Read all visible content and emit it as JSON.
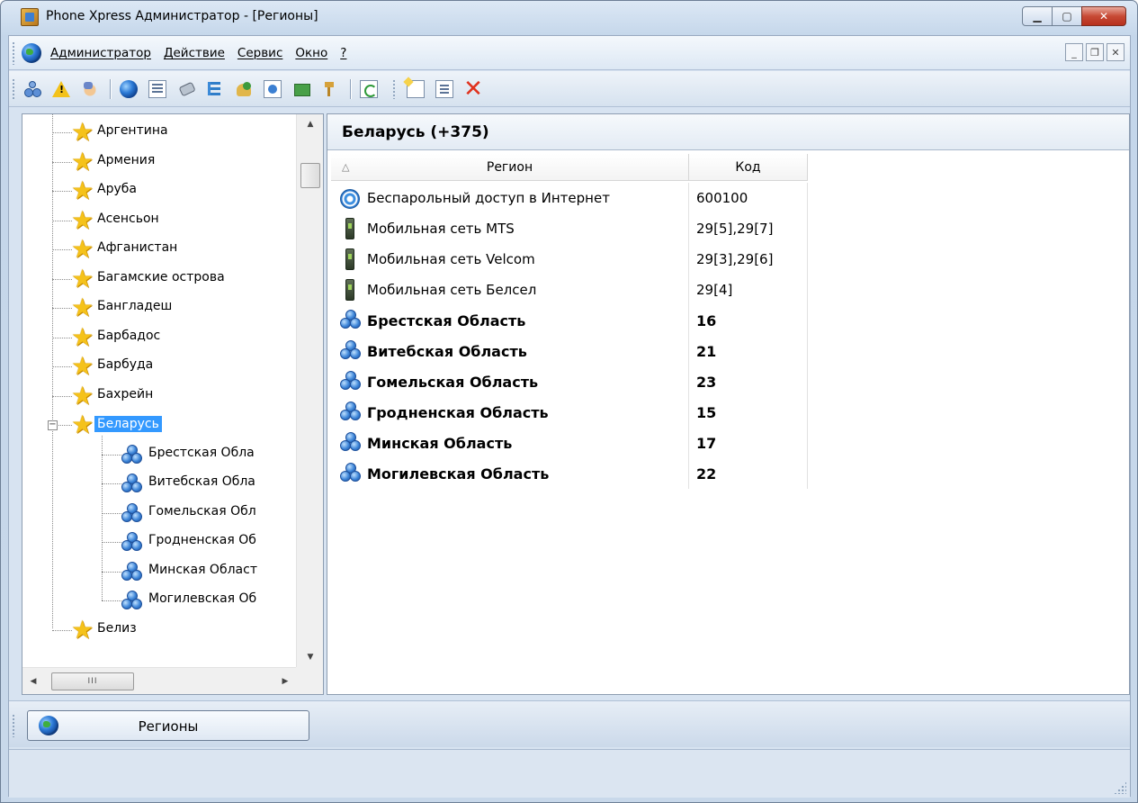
{
  "window": {
    "title": "Phone Xpress Администратор - [Регионы]",
    "caption_buttons": [
      "minimize",
      "maximize",
      "close"
    ]
  },
  "menubar": {
    "items": [
      "Администратор",
      "Действие",
      "Сервис",
      "Окно",
      "?"
    ],
    "mdi_buttons": [
      "minimize",
      "restore",
      "close"
    ]
  },
  "toolbar": {
    "icons": [
      "network-icon",
      "warning-icon",
      "hand-icon",
      "globe-icon",
      "list-icon",
      "phone-icon",
      "tree-icon",
      "users-icon",
      "document-icon",
      "money-icon",
      "keys-icon",
      "refresh-icon",
      "new-document-icon",
      "properties-icon",
      "delete-icon"
    ]
  },
  "tree": {
    "items": [
      {
        "label": "Аргентина",
        "type": "country"
      },
      {
        "label": "Армения",
        "type": "country"
      },
      {
        "label": "Аруба",
        "type": "country"
      },
      {
        "label": "Асенсьон",
        "type": "country"
      },
      {
        "label": "Афганистан",
        "type": "country"
      },
      {
        "label": "Багамские острова",
        "type": "country"
      },
      {
        "label": "Бангладеш",
        "type": "country"
      },
      {
        "label": "Барбадос",
        "type": "country"
      },
      {
        "label": "Барбуда",
        "type": "country"
      },
      {
        "label": "Бахрейн",
        "type": "country"
      },
      {
        "label": "Беларусь",
        "type": "country",
        "expanded": true,
        "selected": true
      },
      {
        "label": "Брестская Обла",
        "type": "region"
      },
      {
        "label": "Витебская Обла",
        "type": "region"
      },
      {
        "label": "Гомельская Обл",
        "type": "region"
      },
      {
        "label": "Гродненская Об",
        "type": "region"
      },
      {
        "label": "Минская Област",
        "type": "region"
      },
      {
        "label": "Могилевская Об",
        "type": "region"
      },
      {
        "label": "Белиз",
        "type": "country"
      }
    ],
    "expander_symbol": "−",
    "hscroll_thumb_glyph": "III"
  },
  "main": {
    "title": "Беларусь (+375)",
    "columns": {
      "region": "Регион",
      "code": "Код",
      "sort_glyph": "△"
    },
    "rows": [
      {
        "region": "Беспарольный доступ в Интернет",
        "code": "600100",
        "icon": "wifi-icon",
        "bold": false
      },
      {
        "region": "Мобильная сеть MTS",
        "code": "29[5],29[7]",
        "icon": "mobile-icon",
        "bold": false
      },
      {
        "region": "Мобильная сеть Velcom",
        "code": "29[3],29[6]",
        "icon": "mobile-icon",
        "bold": false
      },
      {
        "region": "Мобильная сеть Белсел",
        "code": "29[4]",
        "icon": "mobile-icon",
        "bold": false
      },
      {
        "region": "Брестская Область",
        "code": "16",
        "icon": "region-icon",
        "bold": true
      },
      {
        "region": "Витебская Область",
        "code": "21",
        "icon": "region-icon",
        "bold": true
      },
      {
        "region": "Гомельская Область",
        "code": "23",
        "icon": "region-icon",
        "bold": true
      },
      {
        "region": "Гродненская Область",
        "code": "15",
        "icon": "region-icon",
        "bold": true
      },
      {
        "region": "Минская Область",
        "code": "17",
        "icon": "region-icon",
        "bold": true
      },
      {
        "region": "Могилевская Область",
        "code": "22",
        "icon": "region-icon",
        "bold": true
      }
    ]
  },
  "tabbar": {
    "tab_label": "Регионы"
  },
  "colors": {
    "selection": "#3399ff",
    "star": "#f5c21b",
    "delete": "#e0321e"
  }
}
